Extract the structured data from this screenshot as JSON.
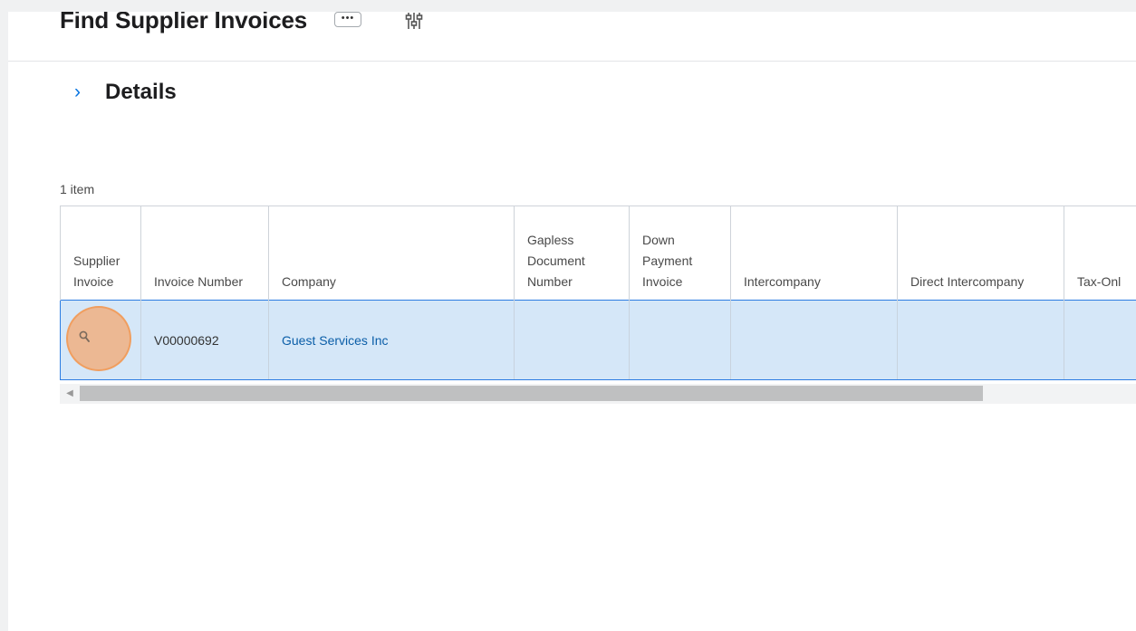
{
  "page": {
    "title": "Find Supplier Invoices",
    "more_label": "•••",
    "section_title": "Details",
    "section_chevron": "›",
    "item_count": "1 item"
  },
  "icons": {
    "more": "ellipsis-icon",
    "filter": "filter-icon",
    "chevron": "chevron-right-icon",
    "search": "search-icon"
  },
  "table": {
    "columns": [
      "Supplier Invoice",
      "Invoice Number",
      "Company",
      "Gapless Document Number",
      "Down Payment Invoice",
      "Intercompany",
      "Direct Intercompany",
      "Tax-Onl"
    ],
    "rows": [
      {
        "invoice_number": "V00000692",
        "company": "Guest Services Inc",
        "gapless_document_number": "",
        "down_payment_invoice": "",
        "intercompany": "",
        "direct_intercompany": "",
        "tax_only": ""
      }
    ]
  },
  "colors": {
    "accent": "#0875e1",
    "row_selected": "#d5e7f8",
    "touch_highlight": "#f3a872",
    "link": "#0b5ea8"
  }
}
